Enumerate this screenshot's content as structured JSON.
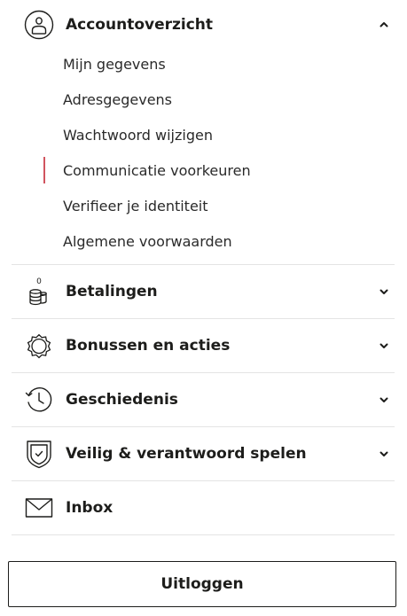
{
  "menu": {
    "account": {
      "title": "Accountoverzicht",
      "icon": "user-icon",
      "expanded": true,
      "items": [
        {
          "label": "Mijn gegevens"
        },
        {
          "label": "Adresgegevens"
        },
        {
          "label": "Wachtwoord wijzigen"
        },
        {
          "label": "Communicatie voorkeuren",
          "active": true
        },
        {
          "label": "Verifieer je identiteit"
        },
        {
          "label": "Algemene voorwaarden"
        }
      ]
    },
    "payments": {
      "title": "Betalingen",
      "icon": "coins-icon",
      "badge": "0"
    },
    "bonuses": {
      "title": "Bonussen en acties",
      "icon": "gear-badge-icon"
    },
    "history": {
      "title": "Geschiedenis",
      "icon": "history-clock-icon"
    },
    "safe_play": {
      "title": "Veilig & verantwoord spelen",
      "icon": "shield-check-icon"
    },
    "inbox": {
      "title": "Inbox",
      "icon": "envelope-icon"
    }
  },
  "logout": {
    "label": "Uitloggen"
  },
  "colors": {
    "text": "#1d1d1b",
    "divider": "#e4e4e4",
    "active_marker": "#d1545f"
  }
}
